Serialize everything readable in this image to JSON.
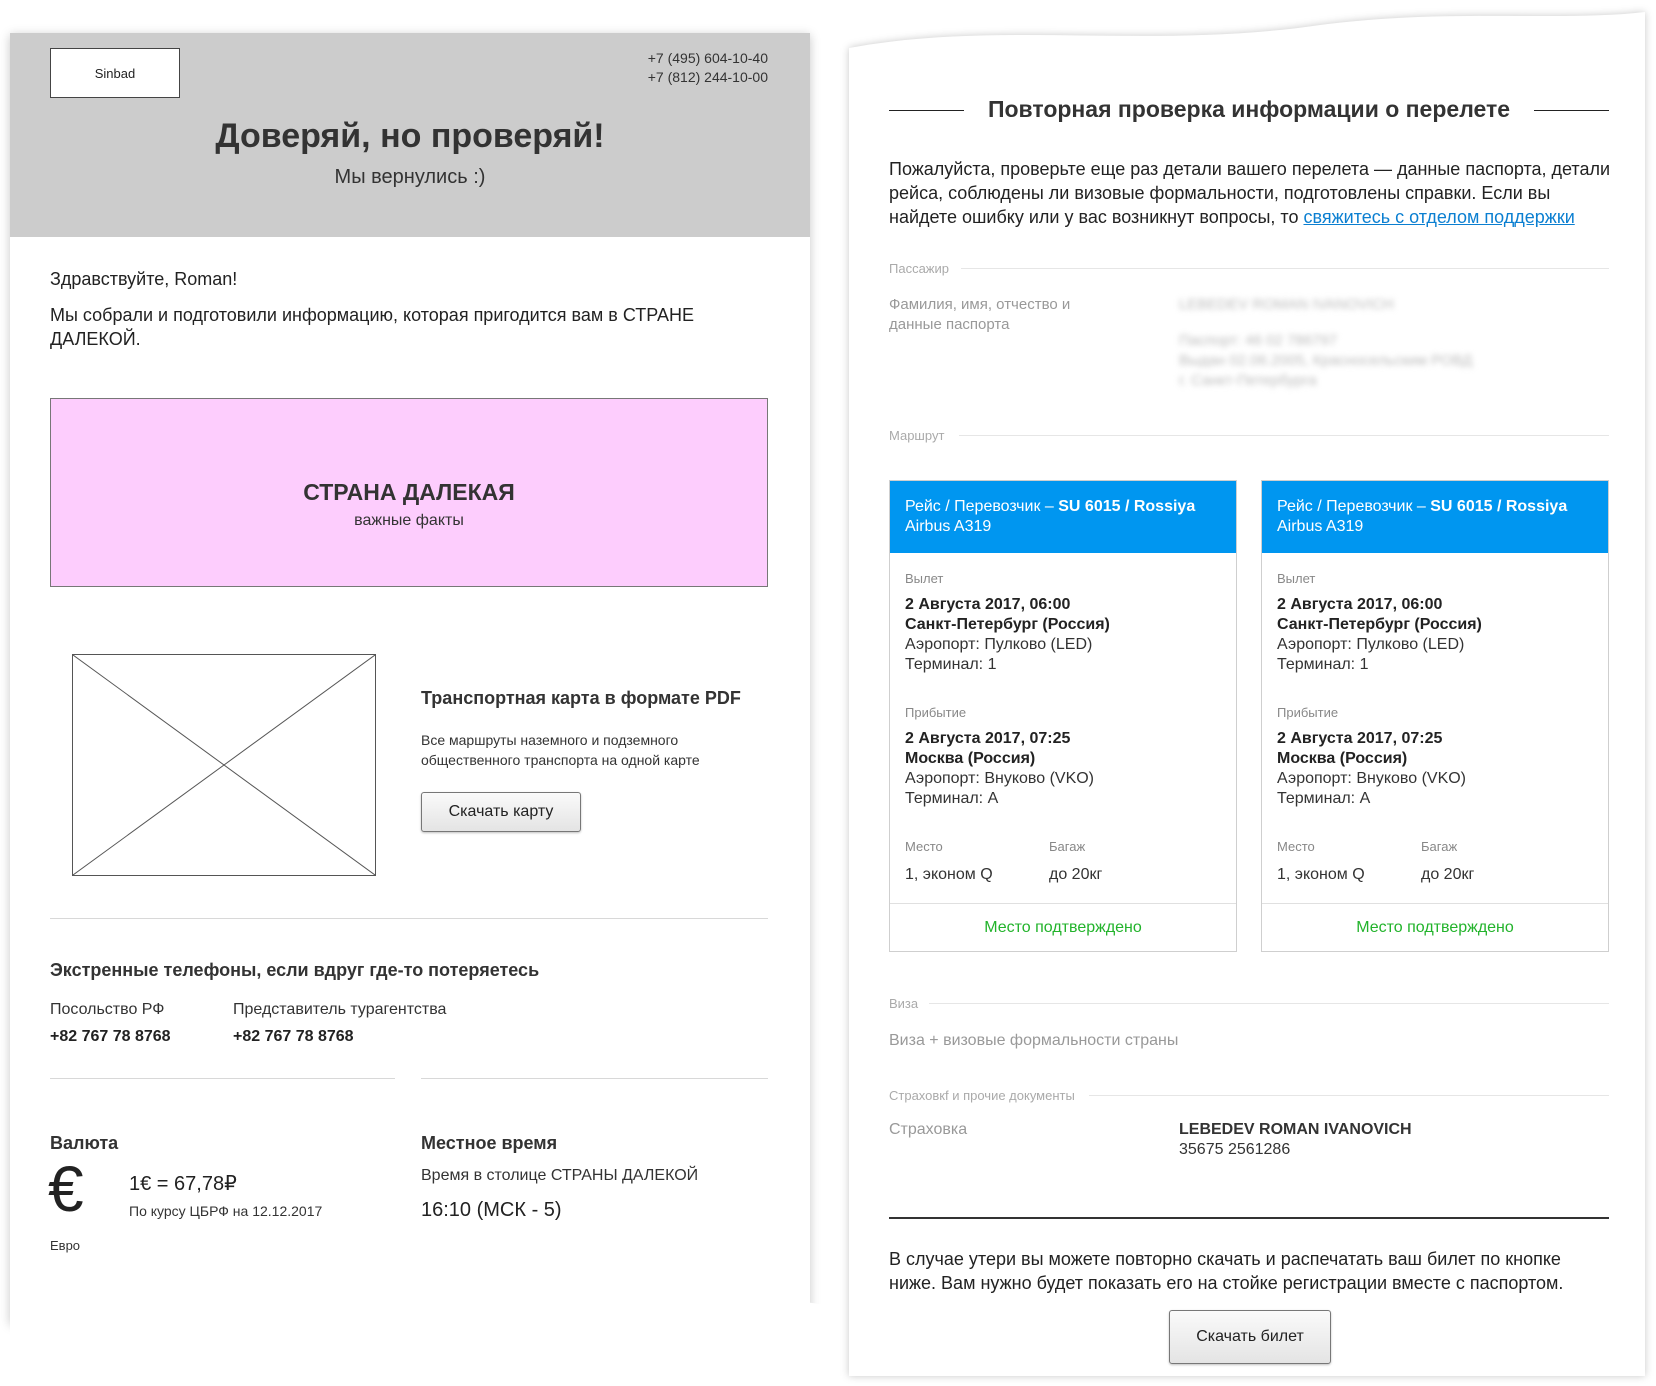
{
  "left": {
    "logo": "Sinbad",
    "phones": [
      "+7 (495) 604-10-40",
      "+7 (812) 244-10-00"
    ],
    "hero_title": "Доверяй, но проверяй!",
    "hero_subtitle": "Мы вернулись :)",
    "greeting": "Здравствуйте, Roman!",
    "intro": "Мы собрали и подготовили информацию, которая пригодится вам в СТРАНЕ ДАЛЕКОЙ.",
    "promo": {
      "title": "СТРАНА ДАЛЕКАЯ",
      "subtitle": "важные факты",
      "color": "#fdcdfd"
    },
    "map": {
      "title": "Транспортная карта в формате PDF",
      "description": "Все маршруты наземного и подземного общественного транспорта на одной карте",
      "button": "Скачать карту"
    },
    "emergency": {
      "title": "Экстренные телефоны, если вдруг где-то потеряетесь",
      "contacts": [
        {
          "label": "Посольство РФ",
          "phone": "+82 767 78 8768"
        },
        {
          "label": "Представитель турагентства",
          "phone": "+82 767 78 8768"
        }
      ]
    },
    "currency": {
      "title": "Валюта",
      "symbol": "€",
      "symbol_label": "Евро",
      "rate": "1€ = 67,78₽",
      "rate_note": "По курсу ЦБРФ на 12.12.2017"
    },
    "local_time": {
      "title": "Местное время",
      "description": "Время в столице СТРАНЫ ДАЛЕКОЙ",
      "value": "16:10 (МСК - 5)"
    }
  },
  "right": {
    "title": "Повторная проверка информации о перелете",
    "intro": "Пожалуйста, проверьте еще раз детали вашего перелета — данные паспорта, детали рейса, соблюдены ли визовые формальности, подготовлены справки. Если вы найдете ошибку или у вас возникнут вопросы, то",
    "support_link": "свяжитесь с отделом поддержки",
    "passenger_section": "Пассажир",
    "passenger_label": "Фамилия, имя, отчество и данные паспорта",
    "passenger_name_redacted": "LEBEDEV ROMAN IVANOVICH",
    "passport_redacted": [
      "Паспорт: 46 02 786797",
      "Выдан 02.06.2005, Красносельским РОВД",
      "г. Санкт-Петербурга"
    ],
    "route_section": "Маршрут",
    "flights": [
      {
        "carrier_prefix": "Рейс / Перевозчик –",
        "carrier": "SU 6015 / Rossiya",
        "aircraft": "Airbus A319",
        "departure_label": "Вылет",
        "departure_datetime": "2 Августа 2017, 06:00",
        "departure_city": "Санкт-Петербург (Россия)",
        "departure_airport": "Аэропорт: Пулково (LED)",
        "departure_terminal": "Терминал: 1",
        "arrival_label": "Прибытие",
        "arrival_datetime": "2 Августа 2017, 07:25",
        "arrival_city": "Москва (Россия)",
        "arrival_airport": "Аэропорт: Внуково (VKO)",
        "arrival_terminal": "Терминал: A",
        "seat_label": "Место",
        "seat": "1, эконом Q",
        "baggage_label": "Багаж",
        "baggage": "до 20кг",
        "status": "Место подтверждено"
      },
      {
        "carrier_prefix": "Рейс / Перевозчик –",
        "carrier": "SU 6015 / Rossiya",
        "aircraft": "Airbus A319",
        "departure_label": "Вылет",
        "departure_datetime": "2 Августа 2017, 06:00",
        "departure_city": "Санкт-Петербург (Россия)",
        "departure_airport": "Аэропорт: Пулково (LED)",
        "departure_terminal": "Терминал: 1",
        "arrival_label": "Прибытие",
        "arrival_datetime": "2 Августа 2017, 07:25",
        "arrival_city": "Москва (Россия)",
        "arrival_airport": "Аэропорт: Внуково (VKO)",
        "arrival_terminal": "Терминал: A",
        "seat_label": "Место",
        "seat": "1, эконом Q",
        "baggage_label": "Багаж",
        "baggage": "до 20кг",
        "status": "Место подтверждено"
      }
    ],
    "visa_section": "Виза",
    "visa_text": "Виза + визовые формальности страны",
    "insurance_section": "Страховкf и прочие документы",
    "insurance_label": "Страховка",
    "insurance_name": "LEBEDEV ROMAN IVANOVICH",
    "insurance_number": "35675 2561286",
    "note": "В случае утери вы можете повторно скачать и распечатать ваш билет по кнопке ниже. Вам нужно будет показать его на стойке регистрации вместе с паспортом.",
    "button": "Скачать билет",
    "colors": {
      "card_header": "#0096f0",
      "status_ok": "#22b32b",
      "link": "#0b7fd1"
    }
  }
}
